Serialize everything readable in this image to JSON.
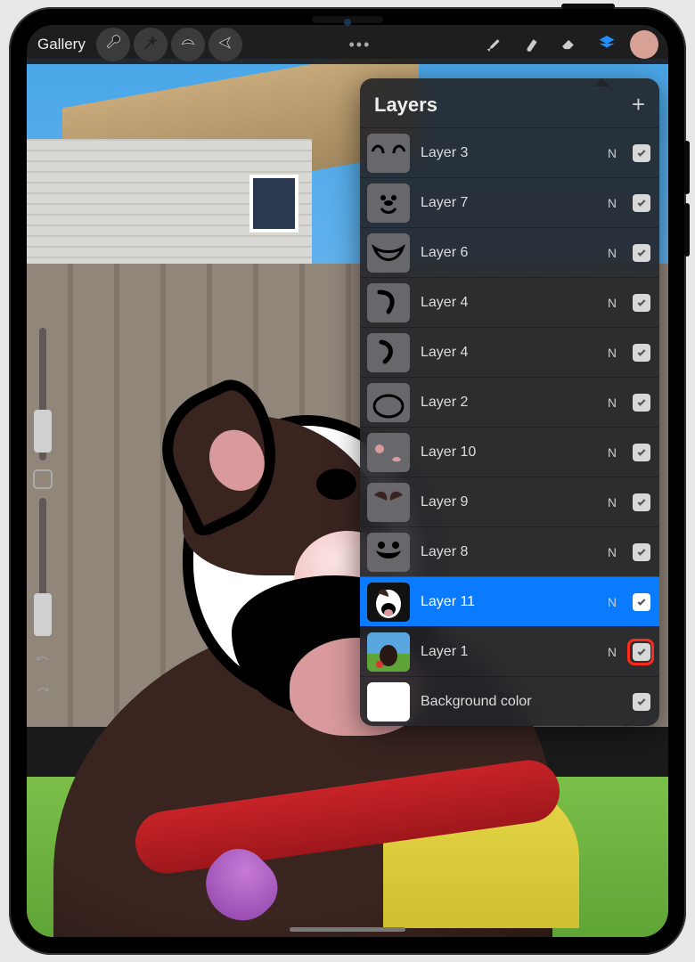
{
  "toolbar": {
    "gallery_label": "Gallery",
    "icons": {
      "wrench": "adjustments",
      "wand": "magic-wand",
      "select": "selection",
      "move": "transform",
      "brush": "brush",
      "smudge": "smudge",
      "eraser": "eraser",
      "layers": "layers",
      "color": "color-picker"
    },
    "accent_color": "#1e90ff",
    "swatch_color": "#d8a196"
  },
  "panel": {
    "title": "Layers",
    "add_label": "+",
    "blend_default": "N",
    "layers": [
      {
        "name": "Layer 3",
        "blend": "N",
        "visible": true,
        "selected": false,
        "thumb": "ears"
      },
      {
        "name": "Layer 7",
        "blend": "N",
        "visible": true,
        "selected": false,
        "thumb": "face"
      },
      {
        "name": "Layer 6",
        "blend": "N",
        "visible": true,
        "selected": false,
        "thumb": "mouth"
      },
      {
        "name": "Layer 4",
        "blend": "N",
        "visible": true,
        "selected": false,
        "thumb": "curve1"
      },
      {
        "name": "Layer 4",
        "blend": "N",
        "visible": true,
        "selected": false,
        "thumb": "curve2"
      },
      {
        "name": "Layer 2",
        "blend": "N",
        "visible": true,
        "selected": false,
        "thumb": "oval"
      },
      {
        "name": "Layer 10",
        "blend": "N",
        "visible": true,
        "selected": false,
        "thumb": "pinkdots"
      },
      {
        "name": "Layer 9",
        "blend": "N",
        "visible": true,
        "selected": false,
        "thumb": "brownfill"
      },
      {
        "name": "Layer 8",
        "blend": "N",
        "visible": true,
        "selected": false,
        "thumb": "blackfill"
      },
      {
        "name": "Layer 11",
        "blend": "N",
        "visible": true,
        "selected": true,
        "thumb": "head"
      },
      {
        "name": "Layer 1",
        "blend": "N",
        "visible": true,
        "selected": false,
        "thumb": "photo",
        "highlight": true
      },
      {
        "name": "Background color",
        "blend": "",
        "visible": true,
        "selected": false,
        "thumb": "bg"
      }
    ]
  }
}
